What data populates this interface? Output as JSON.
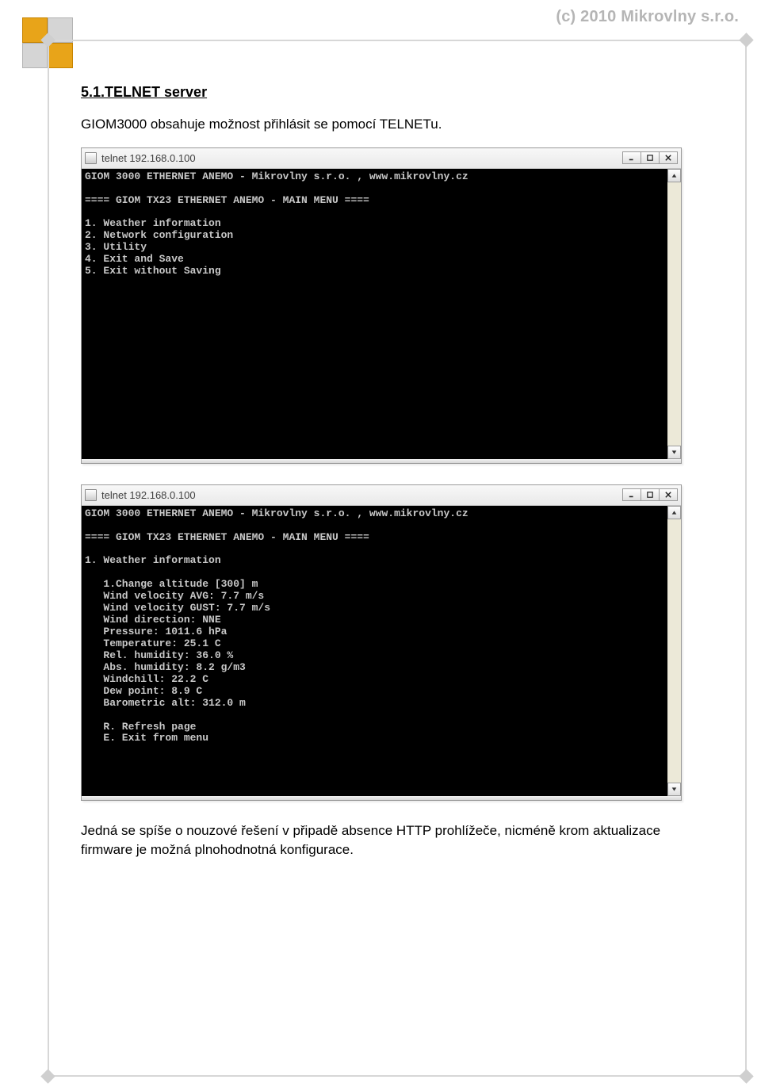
{
  "copyright": "(c) 2010 Mikrovlny s.r.o.",
  "section": {
    "heading": "5.1.TELNET server",
    "intro": "GIOM3000 obsahuje možnost přihlásit se pomocí TELNETu.",
    "outro": "Jedná se spíše o nouzové řešení  v připadě absence  HTTP prohlížeče, nicméně krom aktualizace firmware je možná plnohodnotná konfigurace."
  },
  "window1": {
    "title": "telnet 192.168.0.100",
    "body": "GIOM 3000 ETHERNET ANEMO - Mikrovlny s.r.o. , www.mikrovlny.cz\n\n==== GIOM TX23 ETHERNET ANEMO - MAIN MENU ====\n\n1. Weather information\n2. Network configuration\n3. Utility\n4. Exit and Save\n5. Exit without Saving"
  },
  "window2": {
    "title": "telnet 192.168.0.100",
    "body": "GIOM 3000 ETHERNET ANEMO - Mikrovlny s.r.o. , www.mikrovlny.cz\n\n==== GIOM TX23 ETHERNET ANEMO - MAIN MENU ====\n\n1. Weather information\n\n   1.Change altitude [300] m\n   Wind velocity AVG: 7.7 m/s\n   Wind velocity GUST: 7.7 m/s\n   Wind direction: NNE\n   Pressure: 1011.6 hPa\n   Temperature: 25.1 C\n   Rel. humidity: 36.0 %\n   Abs. humidity: 8.2 g/m3\n   Windchill: 22.2 C\n   Dew point: 8.9 C\n   Barometric alt: 312.0 m\n\n   R. Refresh page\n   E. Exit from menu"
  }
}
